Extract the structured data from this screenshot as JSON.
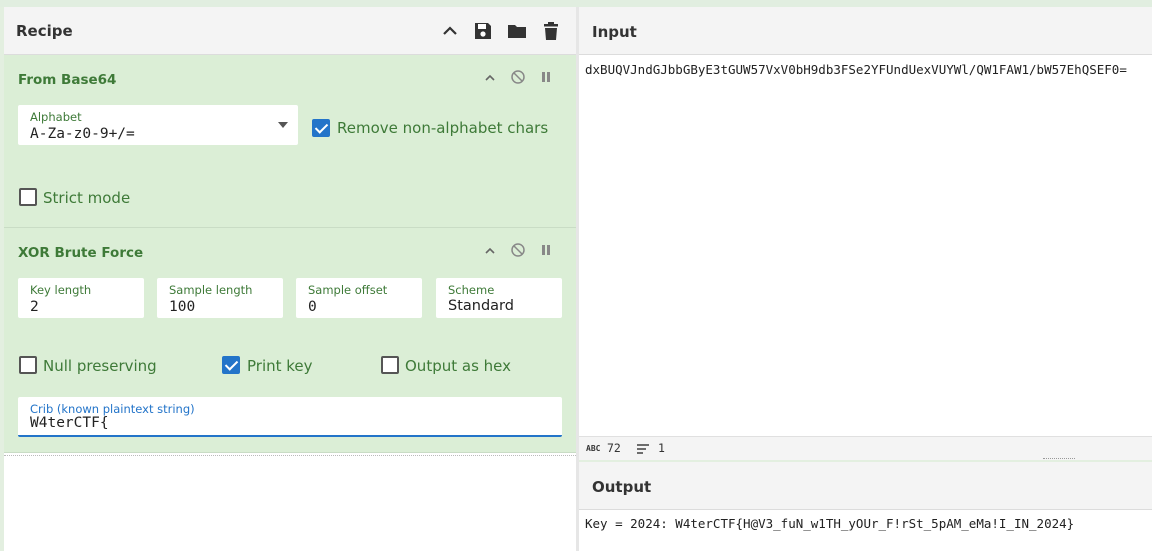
{
  "recipe": {
    "title": "Recipe",
    "operations": [
      {
        "name": "From Base64",
        "alphabet_label": "Alphabet",
        "alphabet_value": "A-Za-z0-9+/=",
        "remove_nonalpha_label": "Remove non-alphabet chars",
        "remove_nonalpha_checked": true,
        "strict_mode_label": "Strict mode",
        "strict_mode_checked": false
      },
      {
        "name": "XOR Brute Force",
        "key_length_label": "Key length",
        "key_length_value": "2",
        "sample_length_label": "Sample length",
        "sample_length_value": "100",
        "sample_offset_label": "Sample offset",
        "sample_offset_value": "0",
        "scheme_label": "Scheme",
        "scheme_value": "Standard",
        "null_preserving_label": "Null preserving",
        "null_preserving_checked": false,
        "print_key_label": "Print key",
        "print_key_checked": true,
        "output_hex_label": "Output as hex",
        "output_hex_checked": false,
        "crib_label": "Crib (known plaintext string)",
        "crib_value": "W4terCTF{"
      }
    ]
  },
  "input": {
    "title": "Input",
    "text": "dxBUQVJndGJbbGByE3tGUW57VxV0bH9db3FSe2YFUndUexVUYWl/QW1FAW1/bW57EhQSEF0=",
    "char_count": "72",
    "line_count": "1"
  },
  "output": {
    "title": "Output",
    "text": "Key = 2024: W4terCTF{H@V3_fuN_w1TH_yOUr_F!rSt_5pAM_eMa!I_IN_2024}"
  },
  "colors": {
    "operation_bg": "#dbeed6",
    "operation_text": "#3e7a38",
    "checkbox_on": "#2374c9",
    "crib_underline": "#2374c9"
  }
}
